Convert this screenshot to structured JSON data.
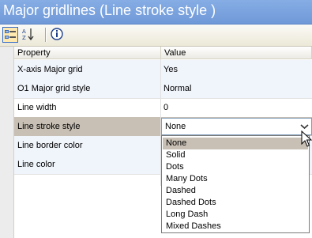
{
  "window": {
    "title": "Major gridlines (Line stroke style )"
  },
  "toolbar": {
    "buttons": [
      {
        "name": "categorized",
        "icon": "categorized-view-icon",
        "active": true
      },
      {
        "name": "alphabetical",
        "icon": "sort-az-icon",
        "active": false
      },
      {
        "name": "property-pages",
        "icon": "info-icon",
        "active": false
      }
    ]
  },
  "grid": {
    "headers": {
      "property": "Property",
      "value": "Value"
    },
    "rows": [
      {
        "property": "X-axis Major grid",
        "value": "Yes"
      },
      {
        "property": "O1 Major grid style",
        "value": "Normal"
      },
      {
        "property": "Line width",
        "value": "0"
      },
      {
        "property": "Line stroke style",
        "value": "None"
      },
      {
        "property": "Line border color",
        "value": ""
      },
      {
        "property": "Line color",
        "value": ""
      }
    ]
  },
  "dropdown": {
    "selected": "None",
    "options": [
      "None",
      "Solid",
      "Dots",
      "Many Dots",
      "Dashed",
      "Dashed Dots",
      "Long Dash",
      "Mixed Dashes"
    ]
  },
  "colors": {
    "title_bar": "#7aa3de",
    "selection": "#c8c0b5",
    "row_alt": "#f0f4fb"
  }
}
